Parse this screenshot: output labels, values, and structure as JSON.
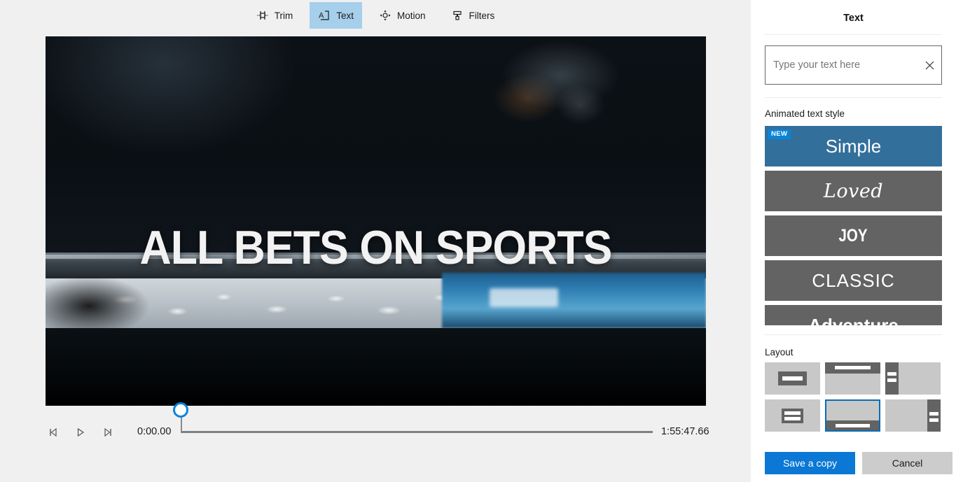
{
  "toolbar": {
    "items": [
      {
        "label": "Trim",
        "icon": "trim-icon",
        "active": false
      },
      {
        "label": "Text",
        "icon": "text-icon",
        "active": true
      },
      {
        "label": "Motion",
        "icon": "motion-icon",
        "active": false
      },
      {
        "label": "Filters",
        "icon": "filters-icon",
        "active": false
      }
    ]
  },
  "video": {
    "overlay_text": "ALL BETS ON SPORTS"
  },
  "transport": {
    "prev_frame": "previous-frame",
    "play": "play",
    "next_frame": "next-frame",
    "current_time": "0:00.00",
    "duration": "1:55:47.66"
  },
  "panel": {
    "title": "Text",
    "text_input": {
      "value": "",
      "placeholder": "Type your text here",
      "clear_label": "✕"
    },
    "animated_style": {
      "label": "Animated text style",
      "items": [
        {
          "label": "Simple",
          "badge": "NEW",
          "selected": true
        },
        {
          "label": "Loved",
          "badge": "",
          "selected": false
        },
        {
          "label": "JOY",
          "badge": "",
          "selected": false
        },
        {
          "label": "CLASSIC",
          "badge": "",
          "selected": false
        },
        {
          "label": "Adventure",
          "badge": "",
          "selected": false
        }
      ]
    },
    "layout": {
      "label": "Layout",
      "items": [
        {
          "name": "center-box",
          "selected": false
        },
        {
          "name": "top-banner",
          "selected": false
        },
        {
          "name": "left-side",
          "selected": false
        },
        {
          "name": "center-two-line",
          "selected": false
        },
        {
          "name": "bottom-banner",
          "selected": true
        },
        {
          "name": "right-side",
          "selected": false
        }
      ]
    },
    "footer": {
      "save_label": "Save a copy",
      "cancel_label": "Cancel"
    }
  },
  "colors": {
    "accent": "#0a78d4",
    "tab_active": "#a6cfeb",
    "tile_selected": "#336f9b",
    "tile_default": "#636363",
    "badge": "#0a84d8"
  }
}
